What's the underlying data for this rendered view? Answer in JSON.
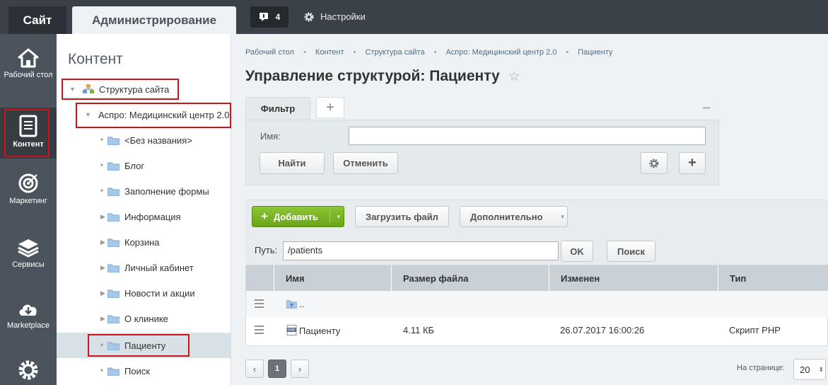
{
  "topbar": {
    "site_tab": "Сайт",
    "admin_tab": "Администрирование",
    "notifications_count": "4",
    "settings_label": "Настройки"
  },
  "leftnav": {
    "items": [
      {
        "label": "Рабочий стол",
        "icon": "home-icon"
      },
      {
        "label": "Контент",
        "icon": "document-icon"
      },
      {
        "label": "Маркетинг",
        "icon": "target-icon"
      },
      {
        "label": "Сервисы",
        "icon": "layers-icon"
      },
      {
        "label": "Marketplace",
        "icon": "cloud-download-icon"
      },
      {
        "label": "",
        "icon": "gear-icon"
      }
    ]
  },
  "sidebar": {
    "title": "Контент",
    "tree": [
      {
        "label": "Структура сайта"
      },
      {
        "label": "Аспро: Медицинский центр 2.0"
      },
      {
        "label": "<Без названия>"
      },
      {
        "label": "Блог"
      },
      {
        "label": "Заполнение формы"
      },
      {
        "label": "Информация"
      },
      {
        "label": "Корзина"
      },
      {
        "label": "Личный кабинет"
      },
      {
        "label": "Новости и акции"
      },
      {
        "label": "О клинике"
      },
      {
        "label": "Пациенту"
      },
      {
        "label": "Поиск"
      }
    ]
  },
  "breadcrumbs": [
    "Рабочий стол",
    "Контент",
    "Структура сайта",
    "Аспро: Медицинский центр 2.0",
    "Пациенту"
  ],
  "page_title": "Управление структурой: Пациенту",
  "filter": {
    "tab_label": "Фильтр",
    "name_label": "Имя:",
    "name_value": "",
    "find_button": "Найти",
    "cancel_button": "Отменить"
  },
  "toolbar": {
    "add_button": "Добавить",
    "upload_button": "Загрузить файл",
    "more_button": "Дополнительно",
    "path_label": "Путь:",
    "path_value": "/patients",
    "ok_button": "OK",
    "search_button": "Поиск"
  },
  "table": {
    "columns": [
      "Имя",
      "Размер файла",
      "Изменен",
      "Тип"
    ],
    "rows": [
      {
        "name": "..",
        "size": "",
        "modified": "",
        "type": ""
      },
      {
        "name": "Пациенту",
        "size": "4.11 КБ",
        "modified": "26.07.2017 16:00:26",
        "type": "Скрипт PHP"
      }
    ]
  },
  "pager": {
    "current_page": "1",
    "per_page_label": "На странице:",
    "per_page_value": "20"
  },
  "colors": {
    "highlight": "#c8161d",
    "add_button": "#7ab526",
    "topbar": "#3a4148"
  }
}
